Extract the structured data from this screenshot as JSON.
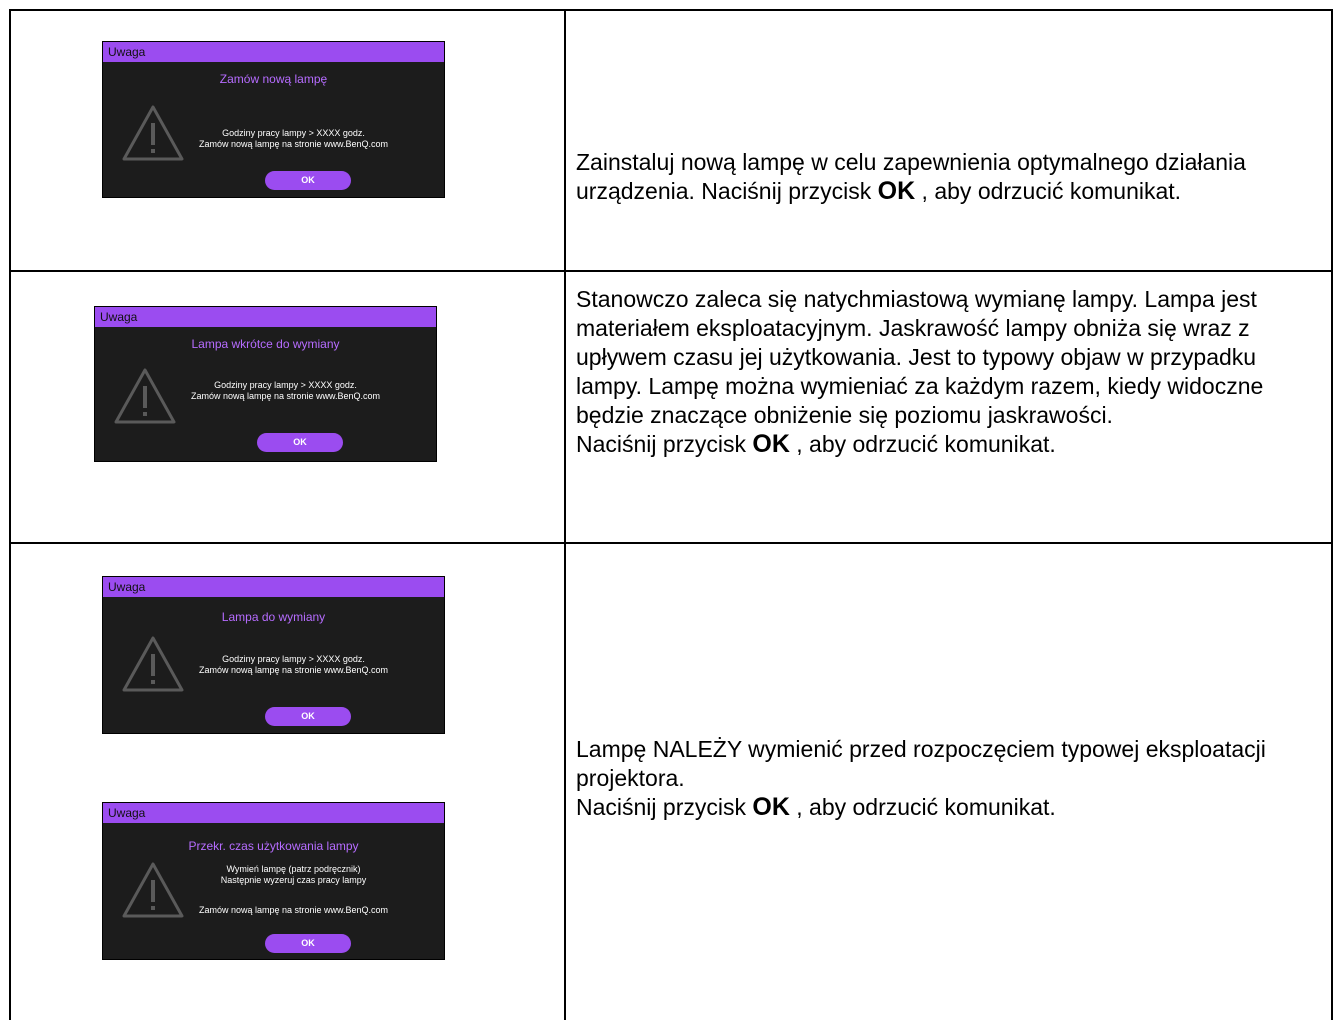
{
  "rows": [
    {
      "dialogs": [
        {
          "header": "Uwaga",
          "title": "Zamów nową lampę",
          "lines": [
            "Godziny pracy lampy > XXXX godz.",
            "Zamów nową lampę na stronie www.BenQ.com"
          ],
          "ok": "OK"
        }
      ],
      "desc": {
        "text1": "Zainstaluj nową lampę w celu zapewnienia optymalnego działania urządzenia. Naciśnij przycisk ",
        "ok": "OK",
        "text2": " , aby odrzucić komunikat."
      }
    },
    {
      "dialogs": [
        {
          "header": "Uwaga",
          "title": "Lampa wkrótce do wymiany",
          "lines": [
            "Godziny pracy lampy > XXXX godz.",
            "Zamów nową lampę na stronie www.BenQ.com"
          ],
          "ok": "OK"
        }
      ],
      "desc": {
        "text1": "Stanowczo zaleca się natychmiastową wymianę lampy. Lampa jest materiałem eksploatacyjnym. Jaskrawość lampy obniża się wraz z upływem czasu jej użytkowania. Jest to typowy objaw w przypadku lampy. Lampę można wymieniać za każdym razem, kiedy widoczne będzie znaczące obniżenie się poziomu jaskrawości.",
        "text2a": "Naciśnij przycisk ",
        "ok": "OK",
        "text2b": " , aby odrzucić komunikat."
      }
    },
    {
      "dialogs": [
        {
          "header": "Uwaga",
          "title": "Lampa do wymiany",
          "lines": [
            "Godziny pracy lampy > XXXX godz.",
            "Zamów nową lampę na stronie www.BenQ.com"
          ],
          "ok": "OK"
        },
        {
          "header": "Uwaga",
          "title": "Przekr. czas użytkowania lampy",
          "lines": [
            "Wymień lampę (patrz podręcznik)",
            "Następnie wyzeruj czas pracy lampy",
            "Zamów nową lampę na stronie www.BenQ.com"
          ],
          "ok": "OK"
        }
      ],
      "desc": {
        "text1": "Lampę NALEŻY wymienić przed rozpoczęciem typowej eksploatacji projektora.",
        "text2a": "Naciśnij przycisk ",
        "ok": "OK",
        "text2b": " , aby odrzucić komunikat."
      }
    }
  ],
  "colors": {
    "header": "#9b4cf0",
    "title": "#b66cff",
    "dialog_bg": "#1c1c1c"
  }
}
